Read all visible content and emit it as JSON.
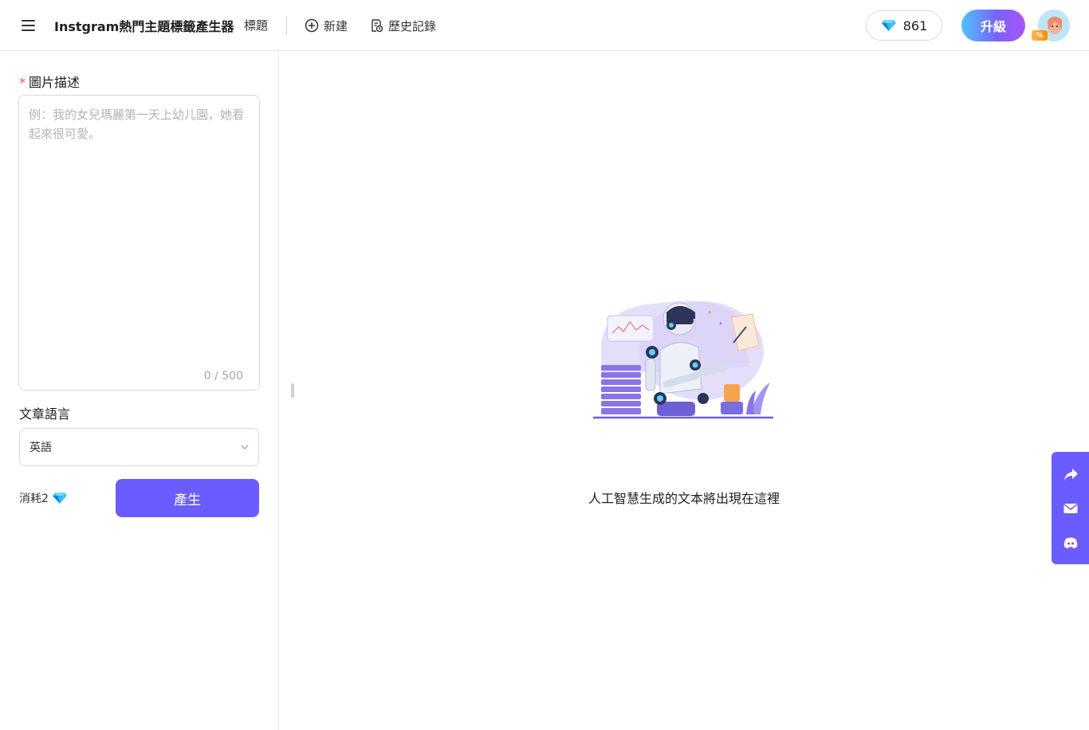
{
  "header": {
    "app_title": "Instgram熱門主題標籤產生器",
    "title_link": "標題",
    "new_label": "新建",
    "history_label": "歷史記錄",
    "credits": "861",
    "upgrade_label": "升級",
    "avatar_badge": "%"
  },
  "form": {
    "description_label": "圖片描述",
    "required_mark": "*",
    "description_value": "",
    "description_placeholder": "例：我的女兒瑪麗第一天上幼儿園，她看起來很可愛。",
    "char_count": "0 / 500",
    "language_label": "文章語言",
    "language_value": "英語",
    "cost_label": "消耗2",
    "generate_label": "產生"
  },
  "main": {
    "empty_text": "人工智慧生成的文本將出現在這裡"
  },
  "side_bar": {
    "items": [
      "share-icon",
      "mail-icon",
      "discord-icon"
    ]
  },
  "colors": {
    "accent": "#6b5cff",
    "required": "#ff4d4f",
    "diamond": "#29b6f6"
  }
}
